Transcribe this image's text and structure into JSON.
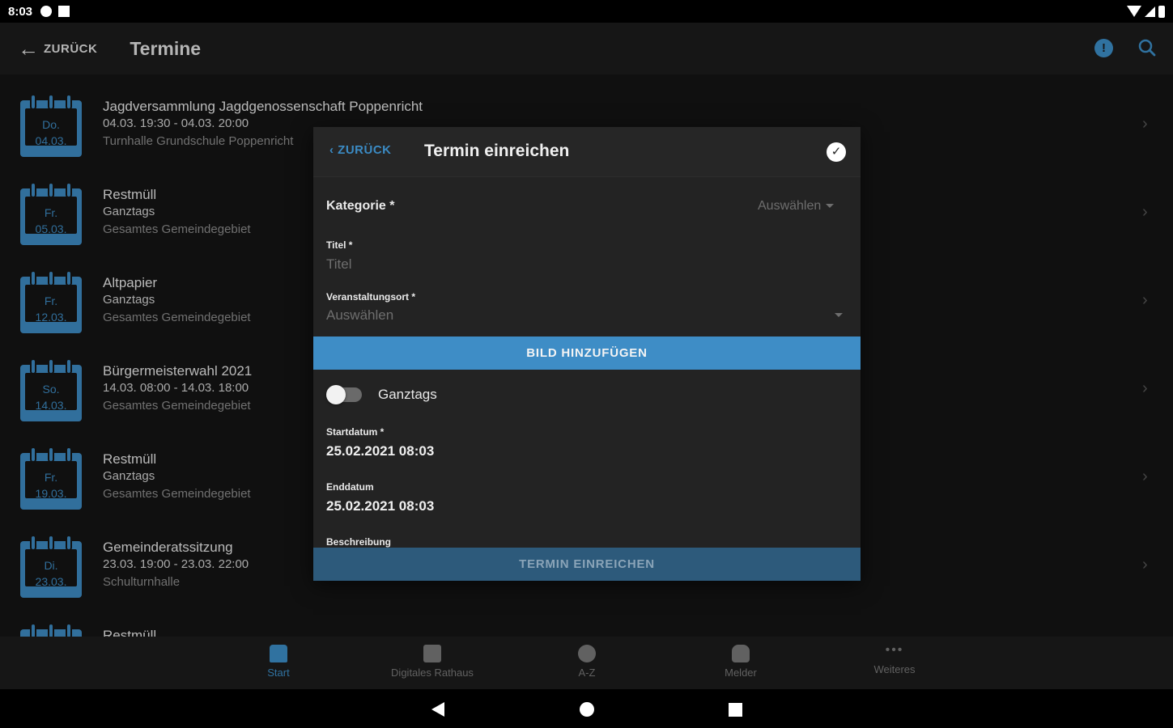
{
  "status_bar": {
    "time": "8:03"
  },
  "appbar": {
    "back_label": "ZURÜCK",
    "title": "Termine"
  },
  "events": [
    {
      "day": "Do.",
      "date": "04.03.",
      "title": "Jagdversammlung Jagdgenossenschaft Poppenricht",
      "time": "04.03. 19:30 - 04.03. 20:00",
      "location": "Turnhalle Grundschule Poppenricht"
    },
    {
      "day": "Fr.",
      "date": "05.03.",
      "title": "Restmüll",
      "time": "Ganztags",
      "location": "Gesamtes Gemeindegebiet"
    },
    {
      "day": "Fr.",
      "date": "12.03.",
      "title": "Altpapier",
      "time": "Ganztags",
      "location": "Gesamtes Gemeindegebiet"
    },
    {
      "day": "So.",
      "date": "14.03.",
      "title": "Bürgermeisterwahl 2021",
      "time": "14.03. 08:00 - 14.03. 18:00",
      "location": "Gesamtes Gemeindegebiet"
    },
    {
      "day": "Fr.",
      "date": "19.03.",
      "title": "Restmüll",
      "time": "Ganztags",
      "location": "Gesamtes Gemeindegebiet"
    },
    {
      "day": "Di.",
      "date": "23.03.",
      "title": "Gemeinderatssitzung",
      "time": "23.03. 19:00 - 23.03. 22:00",
      "location": "Schulturnhalle"
    },
    {
      "day": "",
      "date": "",
      "title": "Restmüll",
      "time": "",
      "location": ""
    }
  ],
  "bottom_nav": [
    {
      "label": "Start",
      "icon": "home-icon"
    },
    {
      "label": "Digitales Rathaus",
      "icon": "rathaus-icon"
    },
    {
      "label": "A-Z",
      "icon": "info-icon"
    },
    {
      "label": "Melder",
      "icon": "hand-icon"
    },
    {
      "label": "Weiteres",
      "icon": "more-icon"
    }
  ],
  "dialog": {
    "back_label": "ZURÜCK",
    "title": "Termin einreichen",
    "kategorie_label": "Kategorie *",
    "kategorie_value": "Auswählen",
    "titel_label": "Titel *",
    "titel_placeholder": "Titel",
    "ort_label": "Veranstaltungsort *",
    "ort_value": "Auswählen",
    "bild_button": "BILD HINZUFÜGEN",
    "ganztags_label": "Ganztags",
    "ganztags_on": false,
    "start_label": "Startdatum *",
    "start_value": "25.02.2021 08:03",
    "end_label": "Enddatum",
    "end_value": "25.02.2021 08:03",
    "beschreibung_label": "Beschreibung",
    "submit_button": "TERMIN EINREICHEN"
  },
  "colors": {
    "accent": "#3b8bc4",
    "background": "#141414",
    "dialog": "#232323"
  }
}
